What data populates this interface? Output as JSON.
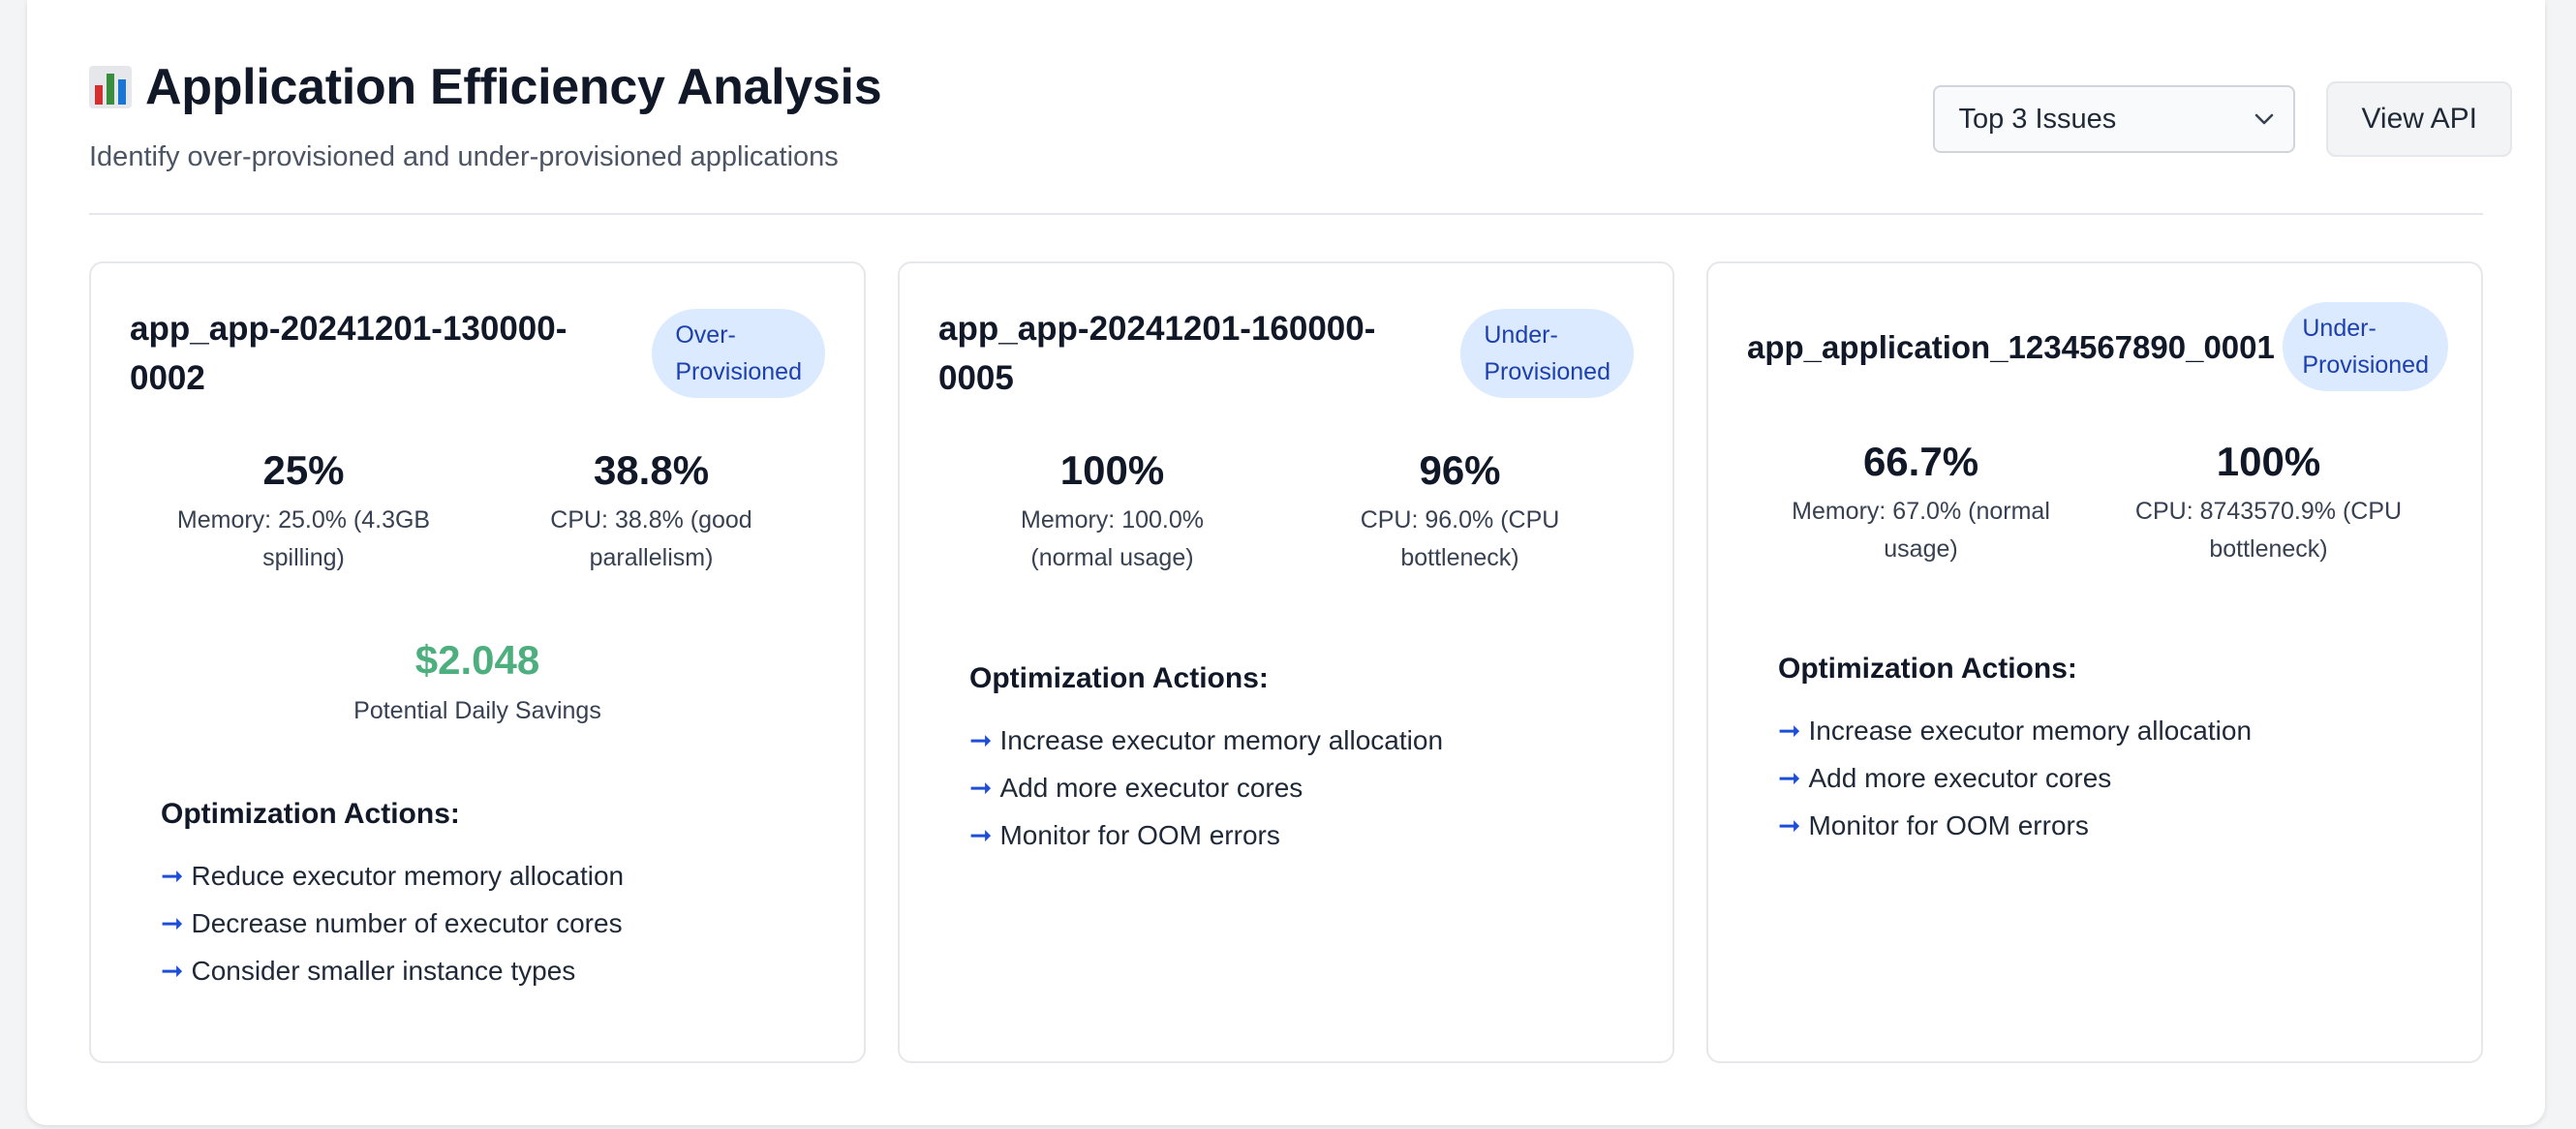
{
  "header": {
    "title": "Application Efficiency Analysis",
    "subtitle": "Identify over-provisioned and under-provisioned applications"
  },
  "controls": {
    "select_value": "Top 3 Issues",
    "view_api_label": "View API"
  },
  "colors": {
    "badge_bg": "#dbeafe",
    "badge_text": "#1e40af",
    "savings": "#4caf7d",
    "arrow": "#1d4ed8"
  },
  "cards": [
    {
      "app_name": "app_app-20241201-130000-0002",
      "badge": "Over-\nProvisioned",
      "memory_value": "25%",
      "memory_label": "Memory: 25.0% (4.3GB spilling)",
      "cpu_value": "38.8%",
      "cpu_label": "CPU: 38.8% (good parallelism)",
      "savings_value": "$2.048",
      "savings_label": "Potential Daily Savings",
      "actions_title": "Optimization Actions:",
      "actions": [
        "Reduce executor memory allocation",
        "Decrease number of executor cores",
        "Consider smaller instance types"
      ]
    },
    {
      "app_name": "app_app-20241201-160000-0005",
      "badge": "Under-\nProvisioned",
      "memory_value": "100%",
      "memory_label": "Memory: 100.0% (normal usage)",
      "cpu_value": "96%",
      "cpu_label": "CPU: 96.0% (CPU bottleneck)",
      "actions_title": "Optimization Actions:",
      "actions": [
        "Increase executor memory allocation",
        "Add more executor cores",
        "Monitor for OOM errors"
      ]
    },
    {
      "app_name": "app_application_1234567890_0001",
      "badge": "Under-\nProvisioned",
      "memory_value": "66.7%",
      "memory_label": "Memory: 67.0% (normal usage)",
      "cpu_value": "100%",
      "cpu_label": "CPU: 8743570.9% (CPU bottleneck)",
      "actions_title": "Optimization Actions:",
      "actions": [
        "Increase executor memory allocation",
        "Add more executor cores",
        "Monitor for OOM errors"
      ]
    }
  ]
}
